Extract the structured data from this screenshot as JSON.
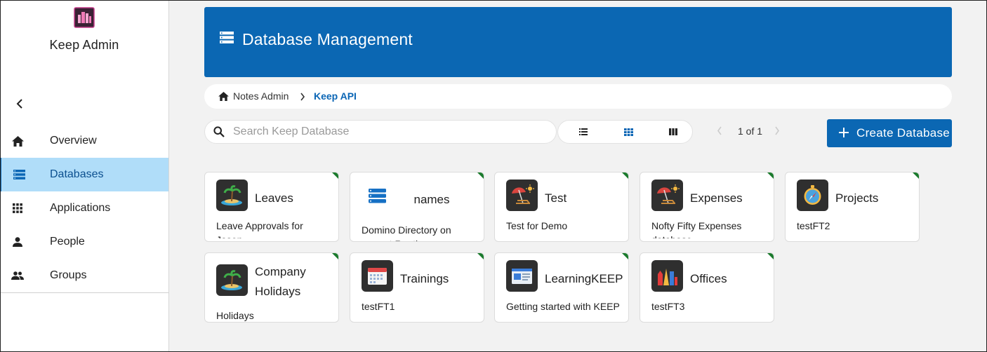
{
  "app": {
    "title": "Keep Admin"
  },
  "sidebar": {
    "collapse_icon": "chevron-left-icon",
    "items": [
      {
        "label": "Overview",
        "icon": "home-icon",
        "active": false
      },
      {
        "label": "Databases",
        "icon": "database-list-icon",
        "active": true
      },
      {
        "label": "Applications",
        "icon": "apps-grid-icon",
        "active": false
      },
      {
        "label": "People",
        "icon": "person-icon",
        "active": false
      },
      {
        "label": "Groups",
        "icon": "group-icon",
        "active": false
      }
    ]
  },
  "header": {
    "title": "Database Management",
    "icon": "database-list-icon"
  },
  "breadcrumb": {
    "home_label": "Notes Admin",
    "current": "Keep API"
  },
  "search": {
    "placeholder": "Search Keep Database",
    "value": ""
  },
  "views": {
    "options": [
      "list-view-icon",
      "grid-view-icon",
      "column-view-icon"
    ],
    "selected": "grid-view-icon"
  },
  "pagination": {
    "text": "1 of 1"
  },
  "create_button": {
    "label": "Create Database"
  },
  "colors": {
    "primary": "#0b67b3",
    "active_nav": "#b0ddf9",
    "card_corner": "#1a7a2c"
  },
  "cards": [
    {
      "title": "Leaves",
      "description": "Leave Approvals for Jason",
      "icon": "island-icon"
    },
    {
      "title": "names",
      "description": "Domino Directory on current Runtime",
      "icon": "database-icon"
    },
    {
      "title": "Test",
      "description": "Test for Demo",
      "icon": "beach-umbrella-icon"
    },
    {
      "title": "Expenses",
      "description": "Nofty Fifty Expenses database",
      "icon": "beach-umbrella-icon"
    },
    {
      "title": "Projects",
      "description": "testFT2",
      "icon": "compass-icon"
    },
    {
      "title": "Company Holidays",
      "title_line1": "Company",
      "title_line2": "Holidays",
      "description": "Holidays",
      "icon": "island-icon"
    },
    {
      "title": "Trainings",
      "description": "testFT1",
      "icon": "calendar-icon"
    },
    {
      "title": "LearningKEEP",
      "description": "Getting started with KEEP",
      "icon": "browser-window-icon"
    },
    {
      "title": "Offices",
      "description": "testFT3",
      "icon": "city-buildings-icon"
    }
  ]
}
